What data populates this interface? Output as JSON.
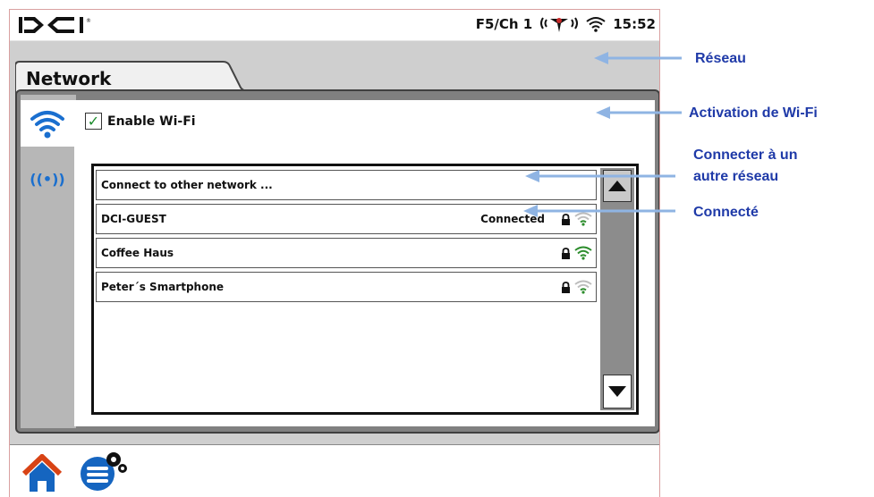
{
  "status_bar": {
    "logo_text": "D⊲I",
    "channel": "F5/Ch 1",
    "time": "15:52",
    "icons": [
      "antenna-signal-icon",
      "wifi-icon"
    ]
  },
  "tab": {
    "label": "Network"
  },
  "side_tabs": [
    {
      "name": "wifi",
      "icon": "wifi-icon"
    },
    {
      "name": "telemetry",
      "icon": "broadcast-icon",
      "glyph": "((•))"
    }
  ],
  "enable_wifi": {
    "label": "Enable Wi-Fi",
    "checked": true,
    "mark": "✓"
  },
  "networks": [
    {
      "name": "Connect to other network ...",
      "status": "",
      "locked": false,
      "signal": ""
    },
    {
      "name": "DCI-GUEST",
      "status": "Connected",
      "locked": true,
      "signal": "weak"
    },
    {
      "name": "Coffee Haus",
      "status": "",
      "locked": true,
      "signal": "strong"
    },
    {
      "name": "Peter´s Smartphone",
      "status": "",
      "locked": true,
      "signal": "weak"
    }
  ],
  "bottom_bar": {
    "icons": [
      "home-icon",
      "settings-menu-icon"
    ]
  },
  "annotations": {
    "reseau": "Réseau",
    "activation": "Activation de Wi-Fi",
    "connect_other_line1": "Connecter à un",
    "connect_other_line2": "autre réseau",
    "connecte": "Connecté"
  },
  "colors": {
    "annotation_text": "#1f3aa8",
    "annotation_arrow": "#8fb4e3",
    "wifi_blue": "#1a6fcf",
    "signal_green": "#2b8c2b",
    "home_blue": "#1565c0",
    "home_roof": "#d84315"
  }
}
